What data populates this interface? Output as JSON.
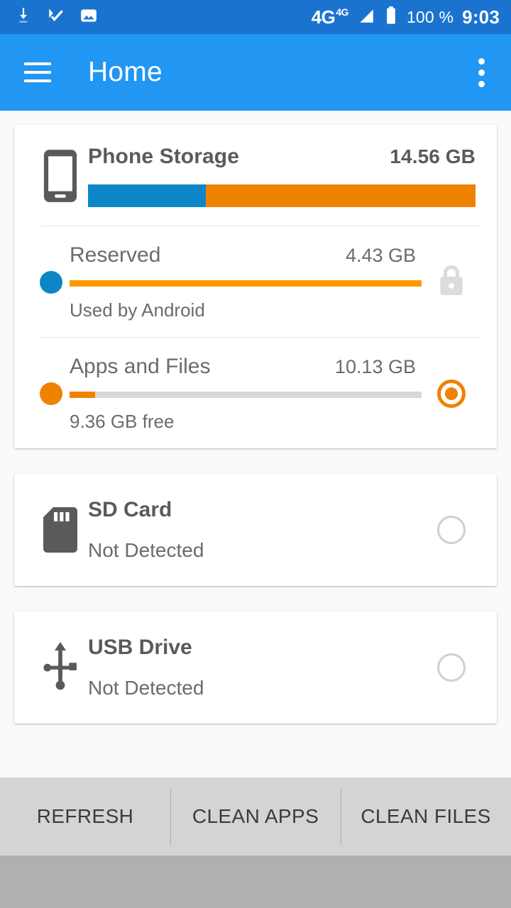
{
  "status_bar": {
    "icons": [
      "download-icon",
      "task-check-icon",
      "photo-icon"
    ],
    "network": "4G",
    "network_sup": "4G",
    "battery_percent": "100 %",
    "time": "9:03"
  },
  "app_bar": {
    "menu_icon": "hamburger-menu-icon",
    "title": "Home",
    "overflow_icon": "overflow-menu-icon"
  },
  "phone_storage": {
    "icon": "phone-icon",
    "title": "Phone Storage",
    "total": "14.56 GB",
    "bar": {
      "reserved_pct": 30.4,
      "apps_pct": 69.6,
      "reserved_color": "#0d86c8",
      "apps_color": "#ef8200"
    },
    "rows": [
      {
        "dot_color": "#0d86c8",
        "title": "Reserved",
        "value": "4.43 GB",
        "fill_pct": 100,
        "fill_color": "#ff9800",
        "note": "Used by Android",
        "trailing": "lock-icon"
      },
      {
        "dot_color": "#ef8200",
        "title": "Apps and Files",
        "value": "10.13 GB",
        "fill_pct": 7.2,
        "fill_color": "#ef8200",
        "note": "9.36 GB free",
        "trailing": "radio-selected"
      }
    ]
  },
  "devices": [
    {
      "icon": "sd-card-icon",
      "title": "SD Card",
      "status": "Not Detected",
      "selected": false
    },
    {
      "icon": "usb-drive-icon",
      "title": "USB Drive",
      "status": "Not Detected",
      "selected": false
    }
  ],
  "bottom_bar": {
    "buttons": [
      {
        "label": "REFRESH"
      },
      {
        "label": "CLEAN APPS"
      },
      {
        "label": "CLEAN FILES"
      }
    ]
  },
  "colors": {
    "status_bar": "#1b73d0",
    "app_bar": "#2196f3",
    "accent_blue": "#0d86c8",
    "accent_orange": "#ef8200",
    "bright_orange": "#ff9800",
    "page_bg": "#fafafa",
    "button_bar": "#d4d4d4",
    "nav_bar": "#b0b0b0"
  }
}
